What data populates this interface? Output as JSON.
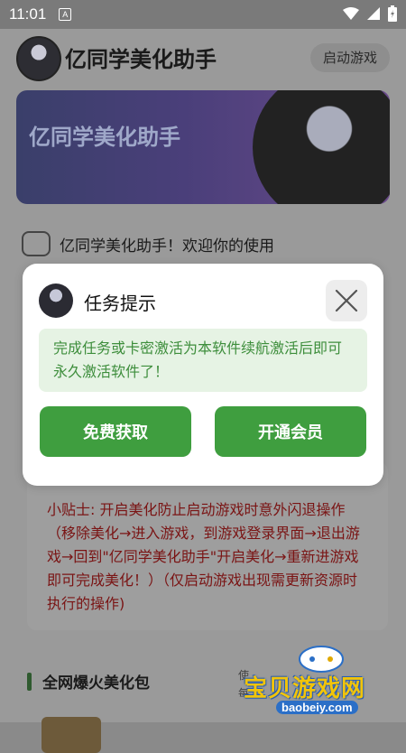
{
  "status_bar": {
    "time": "11:01",
    "notification_icon_letter": "A"
  },
  "app": {
    "title": "亿同学美化助手",
    "launch_button": "启动游戏",
    "banner_text": "亿同学美化助手",
    "welcome": "亿同学美化助手！欢迎你的使用",
    "tips": "小贴士: 开启美化防止启动游戏时意外闪退操作（移除美化→进入游戏，到游戏登录界面→退出游戏→回到\"亿同学美化助手\"开启美化→重新进游戏即可完成美化！）（仅启动游戏出现需更新资源时执行的操作)",
    "section_title": "全网爆火美化包",
    "side_note_1": "使",
    "side_note_2": "每"
  },
  "dialog": {
    "title": "任务提示",
    "message": "完成任务或卡密激活为本软件续航激活后即可永久激活软件了！",
    "free_button": "免费获取",
    "member_button": "开通会员"
  },
  "watermark": {
    "text": "宝贝游戏网",
    "url": "baobeiy.com"
  },
  "colors": {
    "accent_green": "#3f9e3f",
    "message_bg": "#e6f3e4",
    "message_text": "#3e8e3c",
    "tips_text": "#7a1414"
  },
  "icons": [
    "wifi-icon",
    "signal-icon",
    "battery-icon",
    "close-icon",
    "gamepad-icon"
  ]
}
